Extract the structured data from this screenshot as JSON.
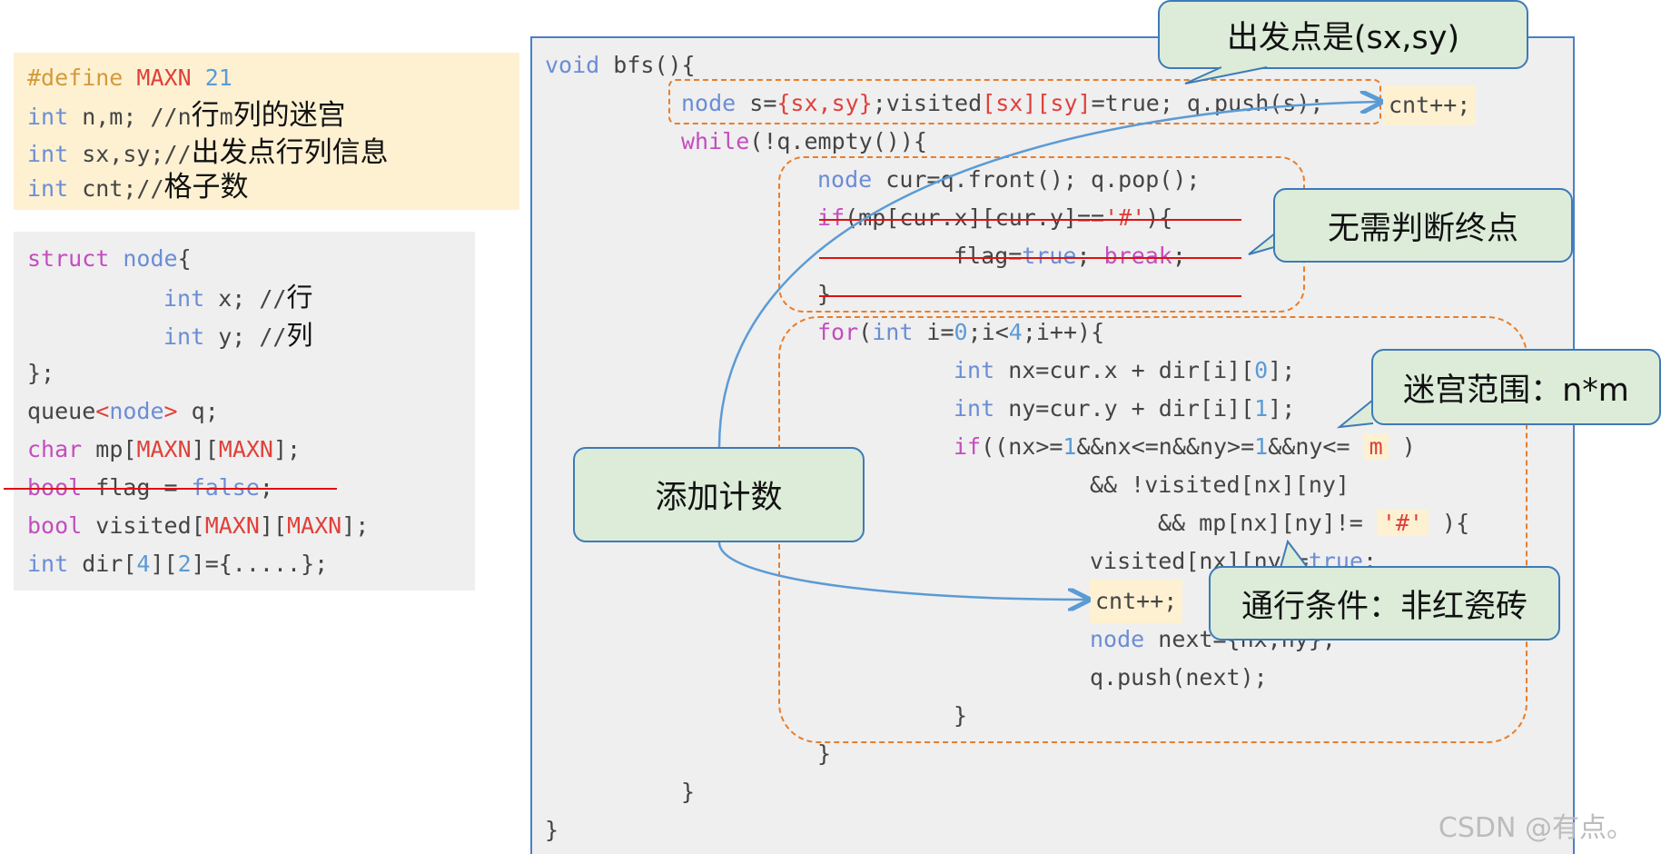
{
  "defines": {
    "l1": {
      "pre": "#define",
      "name": "MAXN",
      "val": "21"
    },
    "l2": {
      "kw": "int",
      "code": " n,m; //n",
      "cn1": "行",
      "m": "m",
      "cn2": "列的迷宫"
    },
    "l3": {
      "kw": "int",
      "code": " sx,sy;//",
      "cn": "出发点行列信息"
    },
    "l4": {
      "kw": "int",
      "code": " cnt;//",
      "cn": "格子数"
    }
  },
  "structs": {
    "s1": {
      "kw": "struct",
      "name": " node",
      "rest": "{"
    },
    "s2": {
      "kw": "int",
      "code": " x; //",
      "cn": "行"
    },
    "s3": {
      "kw": "int",
      "code": " y; //",
      "cn": "列"
    },
    "s4": "};",
    "s5": {
      "a": "queue",
      "b": "<",
      "c": "node",
      "d": ">",
      "e": " q;"
    },
    "s6": {
      "kw": "char",
      "a": " mp[",
      "m1": "MAXN",
      "b": "][",
      "m2": "MAXN",
      "c": "];"
    },
    "s7": {
      "kw": "bool",
      "a": " flag = ",
      "f": "false",
      "b": ";"
    },
    "s8": {
      "kw": "bool",
      "a": " visited[",
      "m1": "MAXN",
      "b": "][",
      "m2": "MAXN",
      "c": "];"
    },
    "s9": {
      "kw": "int",
      "a": " dir[",
      "n1": "4",
      "b": "][",
      "n2": "2",
      "c": "]={.....};"
    }
  },
  "bfs": {
    "c1": {
      "kw": "void",
      "rest": " bfs(){"
    },
    "c2": {
      "kw": "node",
      "a": " s=",
      "b": "{sx,sy}",
      "c": ";visited",
      "d": "[sx][sy]",
      "e": "=true; q.push(s);",
      "cnt": "cnt++;"
    },
    "c3": {
      "kw": "while",
      "rest": "(!q.empty()){"
    },
    "c4": {
      "kw": "node",
      "rest": " cur=q.front(); q.pop();"
    },
    "c5": {
      "kw": "if",
      "a": "(mp[cur.x][cur.y]==",
      "b": "'#'",
      "c": "){"
    },
    "c6": {
      "a": "flag=",
      "b": "true",
      "c": "; ",
      "d": "break",
      "e": ";"
    },
    "c7": "}",
    "c8": {
      "kw": "for",
      "a": "(",
      "kw2": "int",
      "b": " i=",
      "n1": "0",
      "c": ";i<",
      "n2": "4",
      "d": ";i++){"
    },
    "c9": {
      "kw": "int",
      "a": " nx=cur.x + dir[i][",
      "n": "0",
      "b": "];"
    },
    "c10": {
      "kw": "int",
      "a": " ny=cur.y + dir[i][",
      "n": "1",
      "b": "];"
    },
    "c11": {
      "kw": "if",
      "a": "((nx>=",
      "n1": "1",
      "b": "&&nx<=n&&ny>=",
      "n2": "1",
      "c": "&&ny<= ",
      "m": "m",
      "d": " )"
    },
    "c12": "&& !visited[nx][ny]",
    "c13": {
      "a": "&& mp[nx][ny]!= ",
      "b": "'#'",
      "c": " ){"
    },
    "c14": {
      "a": "visited[nx][ny]=",
      "b": "true",
      "c": ";"
    },
    "c15": "cnt++;",
    "c16": {
      "kw": "node",
      "rest": " next={nx,ny};"
    },
    "c17": "q.push(next);",
    "c18": "}",
    "c19": "}",
    "c20": "}",
    "c21": "}"
  },
  "callouts": {
    "start": "出发点是(sx,sy)",
    "no_end": "无需判断终点",
    "range": "迷宫范围：n*m",
    "count": "添加计数",
    "cond": "通行条件：非红瓷砖"
  },
  "watermark": "CSDN @有点。"
}
